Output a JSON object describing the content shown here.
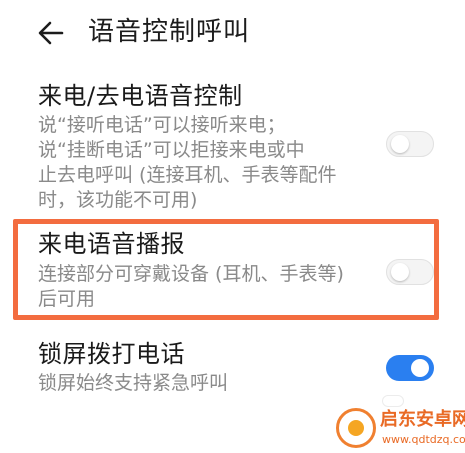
{
  "header": {
    "back_icon": "back-arrow-icon",
    "title": "语音控制呼叫"
  },
  "settings": [
    {
      "title": "来电/去电语音控制",
      "description": "说“接听电话”可以接听来电；\n说“挂断电话”可以拒接来电或中\n止去电呼叫 (连接耳机、手表等配件\n时，该功能不可用)",
      "enabled": false
    },
    {
      "title": "来电语音播报",
      "description": "连接部分可穿戴设备 (耳机、手表等)\n后可用",
      "enabled": false
    },
    {
      "title": "锁屏拨打电话",
      "description": "锁屏始终支持紧急呼叫",
      "enabled": true
    }
  ],
  "colors": {
    "highlight": "#f36c3f",
    "toggle_on": "#2a7ff0",
    "toggle_off": "#f4f4f4"
  },
  "watermark": {
    "name": "启东安卓网",
    "url": "www.qdtdzq.com"
  }
}
